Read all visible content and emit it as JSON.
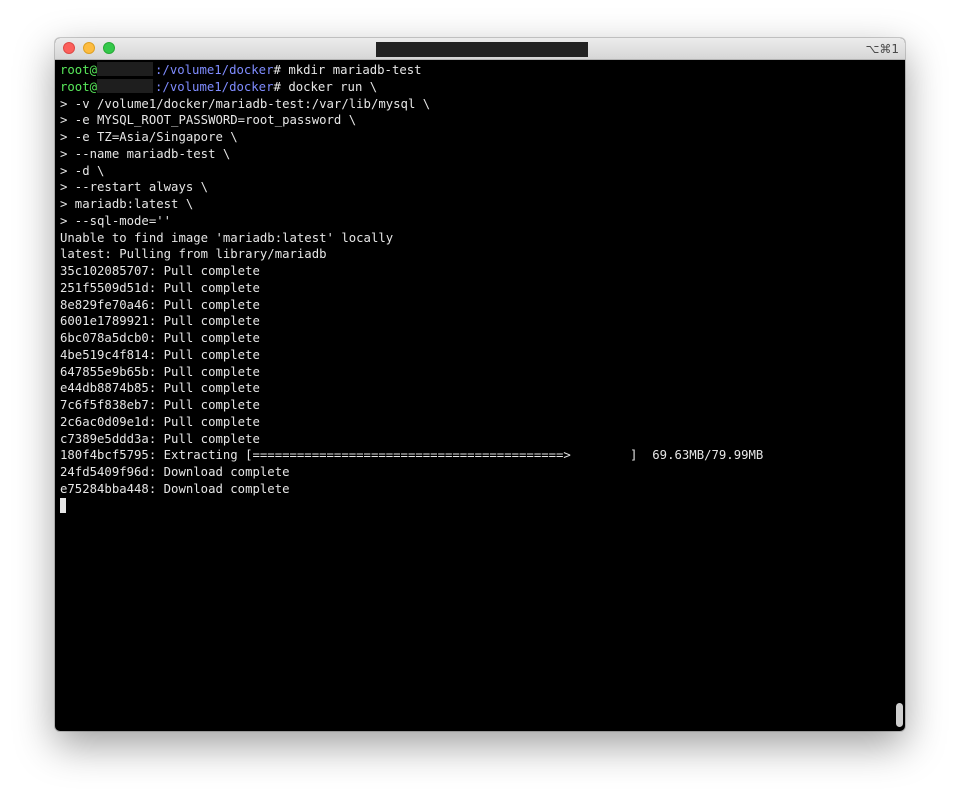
{
  "window": {
    "shortcut": "⌥⌘1"
  },
  "terminal": {
    "prompt_user": "root@",
    "prompt_path": ":/volume1/docker",
    "prompt_symbol": "# ",
    "commands": [
      "mkdir mariadb-test",
      "docker run \\"
    ],
    "continuation": [
      "> -v /volume1/docker/mariadb-test:/var/lib/mysql \\",
      "> -e MYSQL_ROOT_PASSWORD=root_password \\",
      "> -e TZ=Asia/Singapore \\",
      "> --name mariadb-test \\",
      "> -d \\",
      "> --restart always \\",
      "> mariadb:latest \\",
      "> --sql-mode=''"
    ],
    "output": [
      "Unable to find image 'mariadb:latest' locally",
      "latest: Pulling from library/mariadb",
      "35c102085707: Pull complete",
      "251f5509d51d: Pull complete",
      "8e829fe70a46: Pull complete",
      "6001e1789921: Pull complete",
      "6bc078a5dcb0: Pull complete",
      "4be519c4f814: Pull complete",
      "647855e9b65b: Pull complete",
      "e44db8874b85: Pull complete",
      "7c6f5f838eb7: Pull complete",
      "2c6ac0d09e1d: Pull complete",
      "c7389e5ddd3a: Pull complete",
      "180f4bcf5795: Extracting [==========================================>        ]  69.63MB/79.99MB",
      "24fd5409f96d: Download complete",
      "e75284bba448: Download complete"
    ]
  }
}
